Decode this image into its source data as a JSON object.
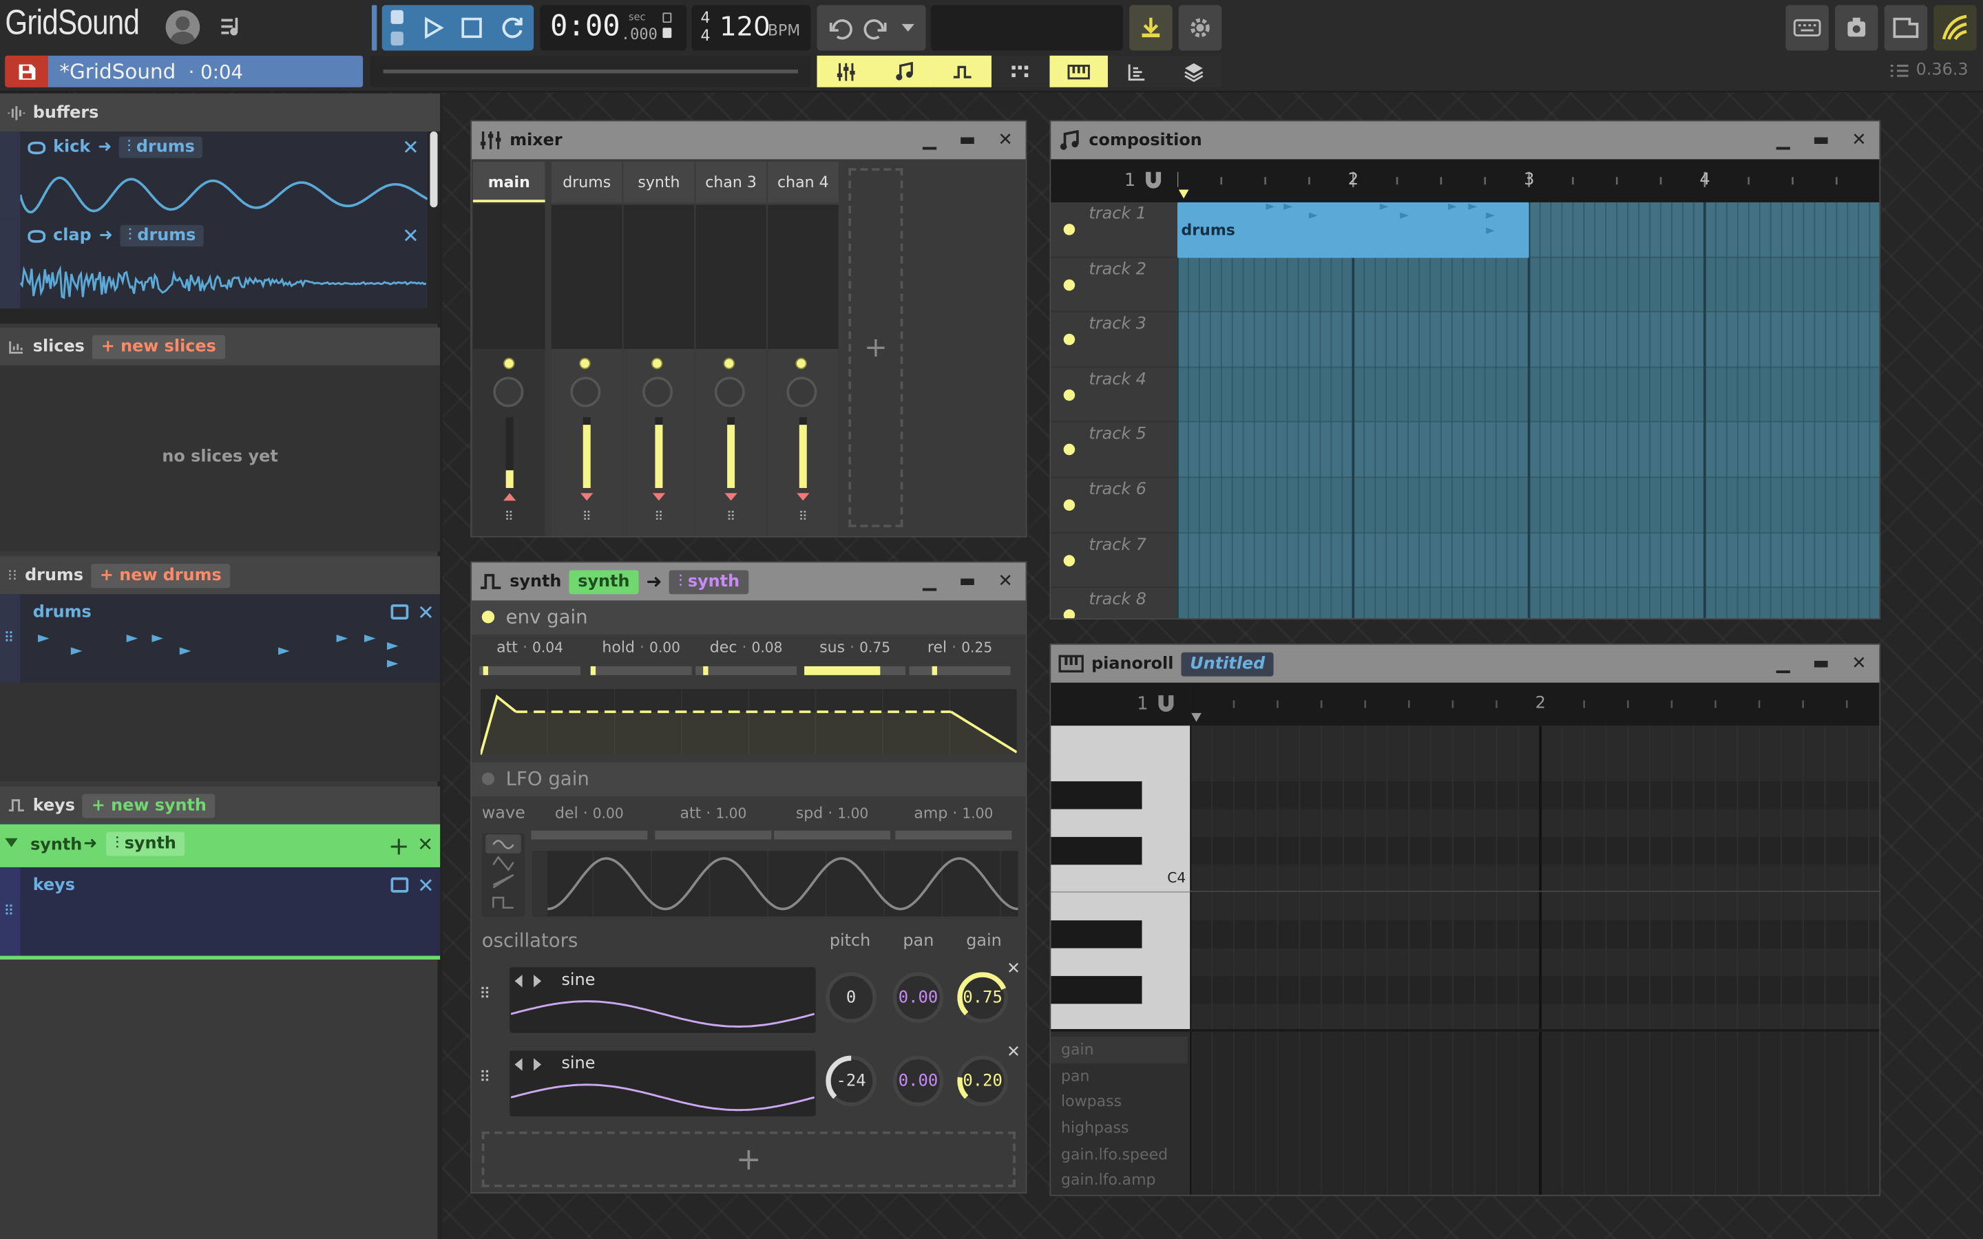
{
  "app": {
    "name": "GridSound",
    "version": "0.36.3"
  },
  "colors": {
    "accent_yellow": "#f5f58c",
    "accent_blue": "#3c78aa",
    "accent_green": "#6fd96f",
    "accent_pink": "#c98af7",
    "drums_blue": "#5aa9d6"
  },
  "titlebar": {
    "song_title": "*GridSound",
    "song_duration": "· 0:04",
    "time_display": "0:00",
    "time_sec_label": "sec",
    "time_ms": ".000",
    "time_sig_top": "4",
    "time_sig_bottom": "4",
    "bpm": "120",
    "bpm_unit": "BPM",
    "icons": [
      "user-avatar-icon",
      "playlist-icon",
      "play-icon",
      "stop-icon",
      "loop-icon",
      "undo-icon",
      "redo-icon",
      "download-icon",
      "settings-icon",
      "keyboard-icon",
      "cookie-icon",
      "fullscreen-icon",
      "app-logo-icon"
    ]
  },
  "panels_toolbar": {
    "items": [
      "mixer-icon",
      "composition-icon",
      "synth-icon",
      "drums-icon",
      "pianoroll-icon",
      "effects-icon",
      "layers-icon"
    ]
  },
  "left": {
    "buffers": {
      "title": "buffers",
      "items": [
        {
          "name": "kick",
          "dest": "drums"
        },
        {
          "name": "clap",
          "dest": "drums"
        }
      ]
    },
    "slices": {
      "title": "slices",
      "new_label": "+ new slices",
      "empty_label": "no slices yet"
    },
    "drums": {
      "title": "drums",
      "new_label": "+ new drums",
      "item_name": "drums"
    },
    "keys": {
      "title": "keys",
      "new_label": "+ new synth",
      "synth_name": "synth",
      "synth_dest": "synth",
      "item_name": "keys"
    }
  },
  "mixer": {
    "title": "mixer",
    "channels": [
      {
        "name": "main",
        "level": 0.25
      },
      {
        "name": "drums",
        "level": 0.9
      },
      {
        "name": "synth",
        "level": 0.9
      },
      {
        "name": "chan 3",
        "level": 0.9
      },
      {
        "name": "chan 4",
        "level": 0.9
      }
    ],
    "add_label": "+"
  },
  "synth": {
    "title": "synth",
    "name_chip": "synth",
    "dest_chip": "synth",
    "env": {
      "title": "env gain",
      "params": [
        {
          "label": "att",
          "value": "0.04"
        },
        {
          "label": "hold",
          "value": "0.00"
        },
        {
          "label": "dec",
          "value": "0.08"
        },
        {
          "label": "sus",
          "value": "0.75"
        },
        {
          "label": "rel",
          "value": "0.25"
        }
      ]
    },
    "lfo": {
      "title": "LFO gain",
      "wave_label": "wave",
      "params": [
        {
          "label": "del",
          "value": "0.00"
        },
        {
          "label": "att",
          "value": "1.00"
        },
        {
          "label": "spd",
          "value": "1.00"
        },
        {
          "label": "amp",
          "value": "1.00"
        }
      ]
    },
    "oscillators": {
      "title": "oscillators",
      "col_pitch": "pitch",
      "col_pan": "pan",
      "col_gain": "gain",
      "items": [
        {
          "wave": "sine",
          "pitch": "0",
          "pan": "0.00",
          "gain": "0.75"
        },
        {
          "wave": "sine",
          "pitch": "-24",
          "pan": "0.00",
          "gain": "0.20"
        }
      ],
      "add_label": "+"
    }
  },
  "composition": {
    "title": "composition",
    "ruler": [
      "1",
      "2",
      "3",
      "4"
    ],
    "tracks": [
      "track 1",
      "track 2",
      "track 3",
      "track 4",
      "track 5",
      "track 6",
      "track 7",
      "track 8"
    ],
    "pattern_label": "drums"
  },
  "pianoroll": {
    "title": "pianoroll",
    "pattern_chip": "Untitled",
    "ruler": [
      "1",
      "2"
    ],
    "key_label": "C4",
    "automation": [
      "gain",
      "pan",
      "lowpass",
      "highpass",
      "gain.lfo.speed",
      "gain.lfo.amp"
    ]
  }
}
